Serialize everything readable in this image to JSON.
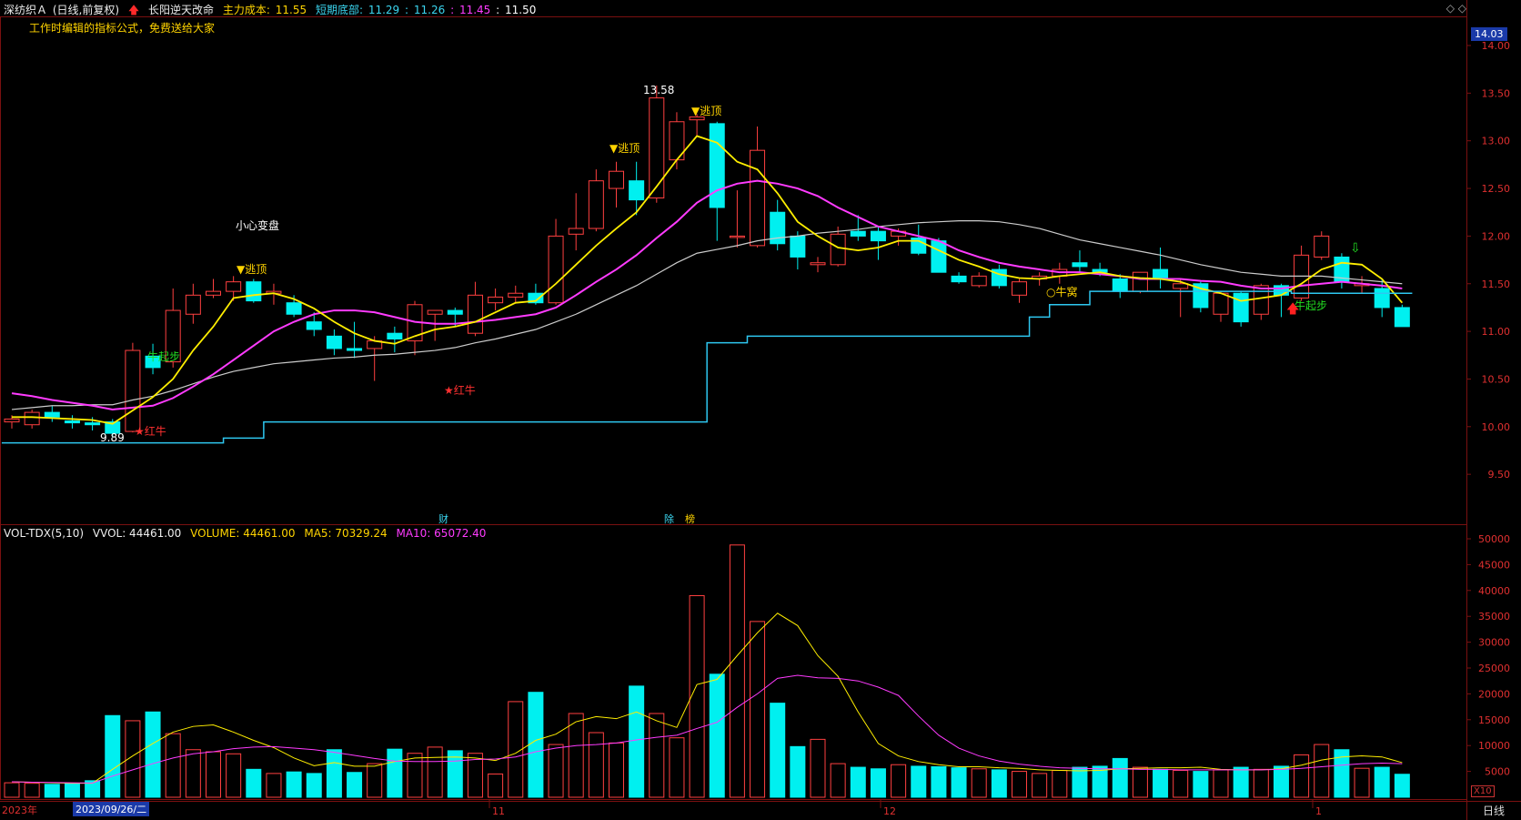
{
  "header": {
    "stock_name": "深纺织Ａ",
    "period": "(日线,前复权)",
    "indicator_name": "长阳逆天改命",
    "items": [
      {
        "label": "主力成本:",
        "value": "11.55",
        "color": "#ffd400"
      },
      {
        "label": "短期底部:",
        "value": "11.29",
        "color": "#3bd6f0"
      },
      {
        "label": ":",
        "value": "11.26",
        "color": "#3bd6f0"
      },
      {
        "label": ":",
        "value": "11.45",
        "color": "#ff3bff"
      },
      {
        "label": ":",
        "value": "11.50",
        "color": "#ffffff"
      }
    ],
    "subtitle": "工作时编辑的指标公式，免费送给大家"
  },
  "price_axis": {
    "ticks": [
      "14.00",
      "13.50",
      "13.00",
      "12.50",
      "12.00",
      "11.50",
      "11.00",
      "10.50",
      "10.00",
      "9.50"
    ],
    "current": "14.03"
  },
  "volume_header": {
    "name": "VOL-TDX(5,10)",
    "vvol": "VVOL: 44461.00",
    "volume": "VOLUME: 44461.00",
    "ma5": "MA5: 70329.24",
    "ma10": "MA10: 65072.40"
  },
  "volume_axis": {
    "ticks": [
      "50000",
      "45000",
      "40000",
      "35000",
      "30000",
      "25000",
      "20000",
      "15000",
      "10000",
      "5000"
    ],
    "multiplier": "X10"
  },
  "time_axis": {
    "year": "2023年",
    "selected_date": "2023/09/26/二",
    "month_labels": [
      "11",
      "12",
      "1"
    ],
    "period_button": "日线"
  },
  "annotations": {
    "high": "13.58",
    "low": "9.89",
    "taoding": "▼逃顶",
    "hongniu": "★红牛",
    "niuqibu": "牛起步",
    "niuwo": "○牛窝",
    "xiaoxin": "小心变盘",
    "cai": "财",
    "fu": "除",
    "bang": "榜"
  },
  "chart_data": {
    "type": "candlestick",
    "candles": [
      {
        "o": 10.05,
        "h": 10.12,
        "l": 9.98,
        "c": 10.08
      },
      {
        "o": 10.02,
        "h": 10.18,
        "l": 9.98,
        "c": 10.15
      },
      {
        "o": 10.15,
        "h": 10.22,
        "l": 10.05,
        "c": 10.1
      },
      {
        "o": 10.06,
        "h": 10.12,
        "l": 9.98,
        "c": 10.04
      },
      {
        "o": 10.04,
        "h": 10.1,
        "l": 9.96,
        "c": 10.02
      },
      {
        "o": 10.05,
        "h": 10.08,
        "l": 9.89,
        "c": 9.93
      },
      {
        "o": 9.95,
        "h": 10.88,
        "l": 9.94,
        "c": 10.8
      },
      {
        "o": 10.74,
        "h": 10.87,
        "l": 10.55,
        "c": 10.62
      },
      {
        "o": 10.68,
        "h": 11.45,
        "l": 10.62,
        "c": 11.22
      },
      {
        "o": 11.18,
        "h": 11.5,
        "l": 11.08,
        "c": 11.38
      },
      {
        "o": 11.38,
        "h": 11.55,
        "l": 11.35,
        "c": 11.42
      },
      {
        "o": 11.42,
        "h": 11.58,
        "l": 11.32,
        "c": 11.52
      },
      {
        "o": 11.52,
        "h": 11.55,
        "l": 11.3,
        "c": 11.32
      },
      {
        "o": 11.4,
        "h": 11.5,
        "l": 11.28,
        "c": 11.42
      },
      {
        "o": 11.3,
        "h": 11.38,
        "l": 11.15,
        "c": 11.18
      },
      {
        "o": 11.1,
        "h": 11.2,
        "l": 10.95,
        "c": 11.02
      },
      {
        "o": 10.95,
        "h": 11.02,
        "l": 10.75,
        "c": 10.82
      },
      {
        "o": 10.82,
        "h": 11.1,
        "l": 10.72,
        "c": 10.8
      },
      {
        "o": 10.82,
        "h": 10.95,
        "l": 10.48,
        "c": 10.9
      },
      {
        "o": 10.98,
        "h": 11.05,
        "l": 10.78,
        "c": 10.92
      },
      {
        "o": 10.9,
        "h": 11.32,
        "l": 10.75,
        "c": 11.28
      },
      {
        "o": 11.18,
        "h": 11.22,
        "l": 10.9,
        "c": 11.22
      },
      {
        "o": 11.22,
        "h": 11.25,
        "l": 11.05,
        "c": 11.18
      },
      {
        "o": 10.98,
        "h": 11.52,
        "l": 10.95,
        "c": 11.38
      },
      {
        "o": 11.3,
        "h": 11.45,
        "l": 11.22,
        "c": 11.36
      },
      {
        "o": 11.36,
        "h": 11.48,
        "l": 11.3,
        "c": 11.4
      },
      {
        "o": 11.4,
        "h": 11.5,
        "l": 11.28,
        "c": 11.3
      },
      {
        "o": 11.3,
        "h": 12.18,
        "l": 11.28,
        "c": 12.0
      },
      {
        "o": 12.02,
        "h": 12.45,
        "l": 11.85,
        "c": 12.08
      },
      {
        "o": 12.08,
        "h": 12.7,
        "l": 12.05,
        "c": 12.58
      },
      {
        "o": 12.5,
        "h": 12.78,
        "l": 12.3,
        "c": 12.68
      },
      {
        "o": 12.58,
        "h": 12.78,
        "l": 12.22,
        "c": 12.38
      },
      {
        "o": 12.4,
        "h": 13.58,
        "l": 12.35,
        "c": 13.45
      },
      {
        "o": 12.8,
        "h": 13.3,
        "l": 12.7,
        "c": 13.2
      },
      {
        "o": 13.22,
        "h": 13.28,
        "l": 13.05,
        "c": 13.25
      },
      {
        "o": 13.18,
        "h": 13.2,
        "l": 11.95,
        "c": 12.3
      },
      {
        "o": 12.0,
        "h": 12.48,
        "l": 11.88,
        "c": 12.0
      },
      {
        "o": 11.9,
        "h": 13.15,
        "l": 11.88,
        "c": 12.9
      },
      {
        "o": 12.25,
        "h": 12.38,
        "l": 11.85,
        "c": 11.92
      },
      {
        "o": 12.0,
        "h": 12.05,
        "l": 11.65,
        "c": 11.78
      },
      {
        "o": 11.7,
        "h": 11.78,
        "l": 11.62,
        "c": 11.72
      },
      {
        "o": 11.7,
        "h": 12.1,
        "l": 11.68,
        "c": 12.02
      },
      {
        "o": 12.05,
        "h": 12.22,
        "l": 11.95,
        "c": 12.0
      },
      {
        "o": 12.05,
        "h": 12.1,
        "l": 11.75,
        "c": 11.95
      },
      {
        "o": 12.0,
        "h": 12.08,
        "l": 11.9,
        "c": 12.05
      },
      {
        "o": 11.98,
        "h": 12.12,
        "l": 11.8,
        "c": 11.82
      },
      {
        "o": 11.95,
        "h": 11.98,
        "l": 11.62,
        "c": 11.62
      },
      {
        "o": 11.58,
        "h": 11.62,
        "l": 11.5,
        "c": 11.52
      },
      {
        "o": 11.48,
        "h": 11.62,
        "l": 11.46,
        "c": 11.58
      },
      {
        "o": 11.65,
        "h": 11.7,
        "l": 11.45,
        "c": 11.48
      },
      {
        "o": 11.38,
        "h": 11.55,
        "l": 11.3,
        "c": 11.52
      },
      {
        "o": 11.55,
        "h": 11.62,
        "l": 11.48,
        "c": 11.58
      },
      {
        "o": 11.58,
        "h": 11.72,
        "l": 11.5,
        "c": 11.65
      },
      {
        "o": 11.72,
        "h": 11.85,
        "l": 11.62,
        "c": 11.68
      },
      {
        "o": 11.65,
        "h": 11.72,
        "l": 11.58,
        "c": 11.62
      },
      {
        "o": 11.55,
        "h": 11.6,
        "l": 11.35,
        "c": 11.42
      },
      {
        "o": 11.42,
        "h": 11.62,
        "l": 11.4,
        "c": 11.62
      },
      {
        "o": 11.65,
        "h": 11.88,
        "l": 11.45,
        "c": 11.55
      },
      {
        "o": 11.45,
        "h": 11.55,
        "l": 11.15,
        "c": 11.5
      },
      {
        "o": 11.5,
        "h": 11.52,
        "l": 11.2,
        "c": 11.25
      },
      {
        "o": 11.18,
        "h": 11.42,
        "l": 11.1,
        "c": 11.4
      },
      {
        "o": 11.4,
        "h": 11.42,
        "l": 11.05,
        "c": 11.1
      },
      {
        "o": 11.18,
        "h": 11.5,
        "l": 11.12,
        "c": 11.48
      },
      {
        "o": 11.48,
        "h": 11.5,
        "l": 11.15,
        "c": 11.38
      },
      {
        "o": 11.35,
        "h": 11.9,
        "l": 11.32,
        "c": 11.8
      },
      {
        "o": 11.78,
        "h": 12.05,
        "l": 11.75,
        "c": 12.0
      },
      {
        "o": 11.78,
        "h": 11.82,
        "l": 11.45,
        "c": 11.52
      },
      {
        "o": 11.48,
        "h": 11.58,
        "l": 11.4,
        "c": 11.5
      },
      {
        "o": 11.45,
        "h": 11.55,
        "l": 11.15,
        "c": 11.25
      },
      {
        "o": 11.25,
        "h": 11.28,
        "l": 11.05,
        "c": 11.05
      }
    ],
    "ma_short": [
      10.1,
      10.1,
      10.09,
      10.08,
      10.07,
      10.03,
      10.17,
      10.31,
      10.5,
      10.8,
      11.05,
      11.35,
      11.38,
      11.4,
      11.34,
      11.24,
      11.1,
      10.98,
      10.9,
      10.87,
      10.95,
      11.02,
      11.05,
      11.1,
      11.2,
      11.3,
      11.32,
      11.5,
      11.7,
      11.9,
      12.08,
      12.25,
      12.52,
      12.8,
      13.05,
      12.98,
      12.78,
      12.7,
      12.45,
      12.15,
      12.0,
      11.88,
      11.85,
      11.88,
      11.95,
      11.95,
      11.85,
      11.75,
      11.68,
      11.6,
      11.56,
      11.55,
      11.58,
      11.6,
      11.62,
      11.58,
      11.56,
      11.55,
      11.52,
      11.45,
      11.4,
      11.32,
      11.35,
      11.38,
      11.5,
      11.65,
      11.72,
      11.7,
      11.55,
      11.3
    ],
    "ma_mid": [
      10.35,
      10.32,
      10.28,
      10.25,
      10.22,
      10.18,
      10.2,
      10.22,
      10.3,
      10.42,
      10.55,
      10.7,
      10.85,
      11.0,
      11.1,
      11.18,
      11.22,
      11.22,
      11.2,
      11.15,
      11.1,
      11.08,
      11.08,
      11.1,
      11.12,
      11.15,
      11.18,
      11.25,
      11.38,
      11.52,
      11.65,
      11.8,
      11.98,
      12.15,
      12.35,
      12.48,
      12.55,
      12.58,
      12.55,
      12.5,
      12.42,
      12.3,
      12.2,
      12.1,
      12.05,
      12.0,
      11.95,
      11.85,
      11.78,
      11.72,
      11.68,
      11.65,
      11.62,
      11.62,
      11.6,
      11.58,
      11.55,
      11.55,
      11.55,
      11.53,
      11.52,
      11.48,
      11.45,
      11.45,
      11.48,
      11.5,
      11.52,
      11.5,
      11.48,
      11.45
    ],
    "ma_long": [
      10.18,
      10.2,
      10.22,
      10.22,
      10.23,
      10.23,
      10.28,
      10.32,
      10.38,
      10.45,
      10.52,
      10.58,
      10.62,
      10.66,
      10.68,
      10.7,
      10.72,
      10.73,
      10.75,
      10.76,
      10.78,
      10.8,
      10.83,
      10.88,
      10.92,
      10.97,
      11.02,
      11.1,
      11.18,
      11.28,
      11.38,
      11.48,
      11.6,
      11.72,
      11.82,
      11.86,
      11.9,
      11.95,
      11.98,
      12.0,
      12.03,
      12.05,
      12.07,
      12.1,
      12.12,
      12.14,
      12.15,
      12.16,
      12.16,
      12.15,
      12.12,
      12.08,
      12.02,
      11.96,
      11.92,
      11.88,
      11.84,
      11.8,
      11.75,
      11.7,
      11.66,
      11.62,
      11.6,
      11.58,
      11.58,
      11.58,
      11.56,
      11.54,
      11.52,
      11.5
    ],
    "support": [
      9.83,
      9.83,
      9.83,
      9.83,
      9.83,
      9.83,
      9.83,
      9.83,
      9.83,
      9.83,
      9.83,
      9.88,
      9.88,
      10.05,
      10.05,
      10.05,
      10.05,
      10.05,
      10.05,
      10.05,
      10.05,
      10.05,
      10.05,
      10.05,
      10.05,
      10.05,
      10.05,
      10.05,
      10.05,
      10.05,
      10.05,
      10.05,
      10.05,
      10.05,
      10.05,
      10.88,
      10.88,
      10.95,
      10.95,
      10.95,
      10.95,
      10.95,
      10.95,
      10.95,
      10.95,
      10.95,
      10.95,
      10.95,
      10.95,
      10.95,
      10.95,
      11.15,
      11.28,
      11.28,
      11.42,
      11.42,
      11.42,
      11.42,
      11.42,
      11.42,
      11.42,
      11.42,
      11.42,
      11.42,
      11.4,
      11.4,
      11.4,
      11.4,
      11.4,
      11.4
    ],
    "volume": [
      2800,
      2700,
      2500,
      2700,
      3200,
      15800,
      14800,
      16500,
      12300,
      9200,
      8800,
      8400,
      5400,
      4600,
      4900,
      4600,
      9200,
      4800,
      6500,
      9300,
      8500,
      9700,
      9000,
      8500,
      4500,
      18500,
      20300,
      10200,
      16200,
      12500,
      10500,
      21500,
      16200,
      11500,
      39000,
      23800,
      48800,
      34000,
      18200,
      9800,
      11200,
      6500,
      5800,
      5500,
      6300,
      6000,
      5900,
      5700,
      5500,
      5300,
      5000,
      4600,
      5200,
      5800,
      6000,
      7500,
      5800,
      5400,
      5200,
      5000,
      5300,
      5800,
      5400,
      6000,
      8200,
      10200,
      9200,
      5600,
      5800,
      4446
    ],
    "vol_ma5": [
      3000,
      2900,
      2800,
      2700,
      2700,
      5400,
      8000,
      10400,
      12600,
      13700,
      14000,
      12600,
      11000,
      9600,
      7600,
      6100,
      6700,
      6000,
      6000,
      6900,
      7600,
      7700,
      7800,
      7600,
      7100,
      8500,
      11000,
      12200,
      14600,
      15600,
      15200,
      16500,
      14800,
      13500,
      21800,
      22800,
      27400,
      31800,
      35600,
      33200,
      27400,
      23400,
      16500,
      10400,
      8000,
      6900,
      6300,
      5900,
      5900,
      5700,
      5600,
      5300,
      5200,
      5100,
      5200,
      5500,
      5600,
      5700,
      5700,
      5800,
      5400,
      5300,
      5300,
      5500,
      6200,
      7200,
      7800,
      8000,
      7800,
      6700
    ],
    "vol_ma10": [
      3000,
      2900,
      2850,
      2800,
      2750,
      4100,
      5300,
      6500,
      7600,
      8400,
      8800,
      9400,
      9700,
      9800,
      9500,
      9200,
      8700,
      8100,
      7500,
      7000,
      6900,
      6900,
      7000,
      7300,
      7400,
      7800,
      8800,
      9500,
      10000,
      10200,
      10500,
      11100,
      11600,
      12000,
      13300,
      14500,
      17400,
      20000,
      23000,
      23600,
      23100,
      23000,
      22500,
      21300,
      19700,
      15700,
      12000,
      9500,
      8000,
      7000,
      6400,
      6000,
      5700,
      5600,
      5500,
      5500,
      5400,
      5400,
      5300,
      5300,
      5300,
      5300,
      5300,
      5400,
      5600,
      5900,
      6200,
      6500,
      6600,
      6500
    ]
  }
}
